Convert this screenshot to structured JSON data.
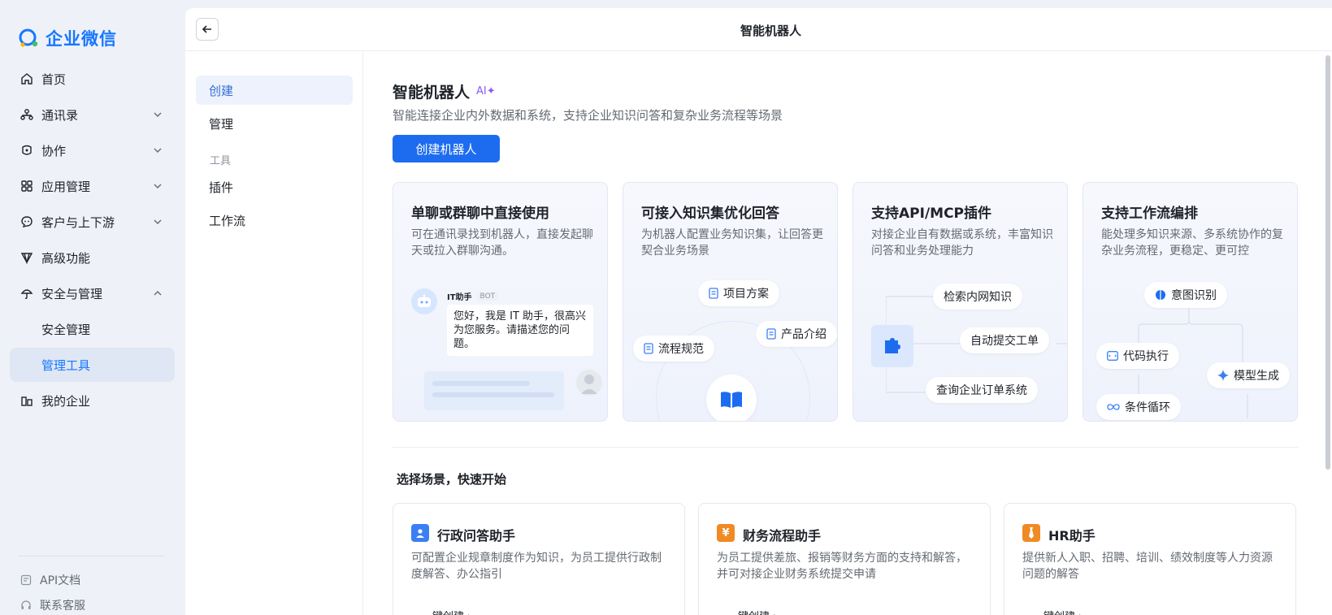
{
  "app": {
    "logo_text": "企业微信"
  },
  "sidebar": {
    "items": [
      {
        "label": "首页"
      },
      {
        "label": "通讯录"
      },
      {
        "label": "协作"
      },
      {
        "label": "应用管理"
      },
      {
        "label": "客户与上下游"
      },
      {
        "label": "高级功能"
      },
      {
        "label": "安全与管理"
      },
      {
        "label": "安全管理"
      },
      {
        "label": "管理工具"
      },
      {
        "label": "我的企业"
      }
    ],
    "footer": [
      {
        "label": "API文档"
      },
      {
        "label": "联系客服"
      }
    ]
  },
  "header": {
    "title": "智能机器人"
  },
  "subnav": {
    "create": "创建",
    "manage": "管理",
    "group_tools": "工具",
    "plugins": "插件",
    "workflow": "工作流"
  },
  "main": {
    "title": "智能机器人",
    "ai_badge": "AI✦",
    "description": "智能连接企业内外数据和系统，支持企业知识问答和复杂业务流程等场景",
    "create_button": "创建机器人",
    "features": [
      {
        "title": "单聊或群聊中直接使用",
        "desc": "可在通讯录找到机器人，直接发起聊天或拉入群聊沟通。",
        "bot_name": "IT助手",
        "bot_tag": "BOT",
        "bot_message": "您好，我是 IT 助手，很高兴为您服务。请描述您的问题。"
      },
      {
        "title": "可接入知识集优化回答",
        "desc": "为机器人配置业务知识集，让回答更契合业务场景",
        "chips": [
          "项目方案",
          "产品介绍",
          "流程规范"
        ]
      },
      {
        "title": "支持API/MCP插件",
        "desc": "对接企业自有数据或系统，丰富知识问答和业务处理能力",
        "chips": [
          "检索内网知识",
          "自动提交工单",
          "查询企业订单系统"
        ]
      },
      {
        "title": "支持工作流编排",
        "desc": "能处理多知识来源、多系统协作的复杂业务流程，更稳定、更可控",
        "chips": [
          "意图识别",
          "代码执行",
          "模型生成",
          "条件循环"
        ]
      }
    ],
    "scenes_title": "选择场景，快速开始",
    "scenes": [
      {
        "title": "行政问答助手",
        "desc": "可配置企业规章制度作为知识，为员工提供行政制度解答、办公指引",
        "link": "一键创建 ›",
        "color": "#3b7ff5"
      },
      {
        "title": "财务流程助手",
        "desc": "为员工提供差旅、报销等财务方面的支持和解答，并可对接企业财务系统提交申请",
        "link": "一键创建 ›",
        "color": "#f08a24"
      },
      {
        "title": "HR助手",
        "desc": "提供新人入职、招聘、培训、绩效制度等人力资源问题的解答",
        "link": "一键创建 ›",
        "color": "#f08a24"
      }
    ]
  }
}
